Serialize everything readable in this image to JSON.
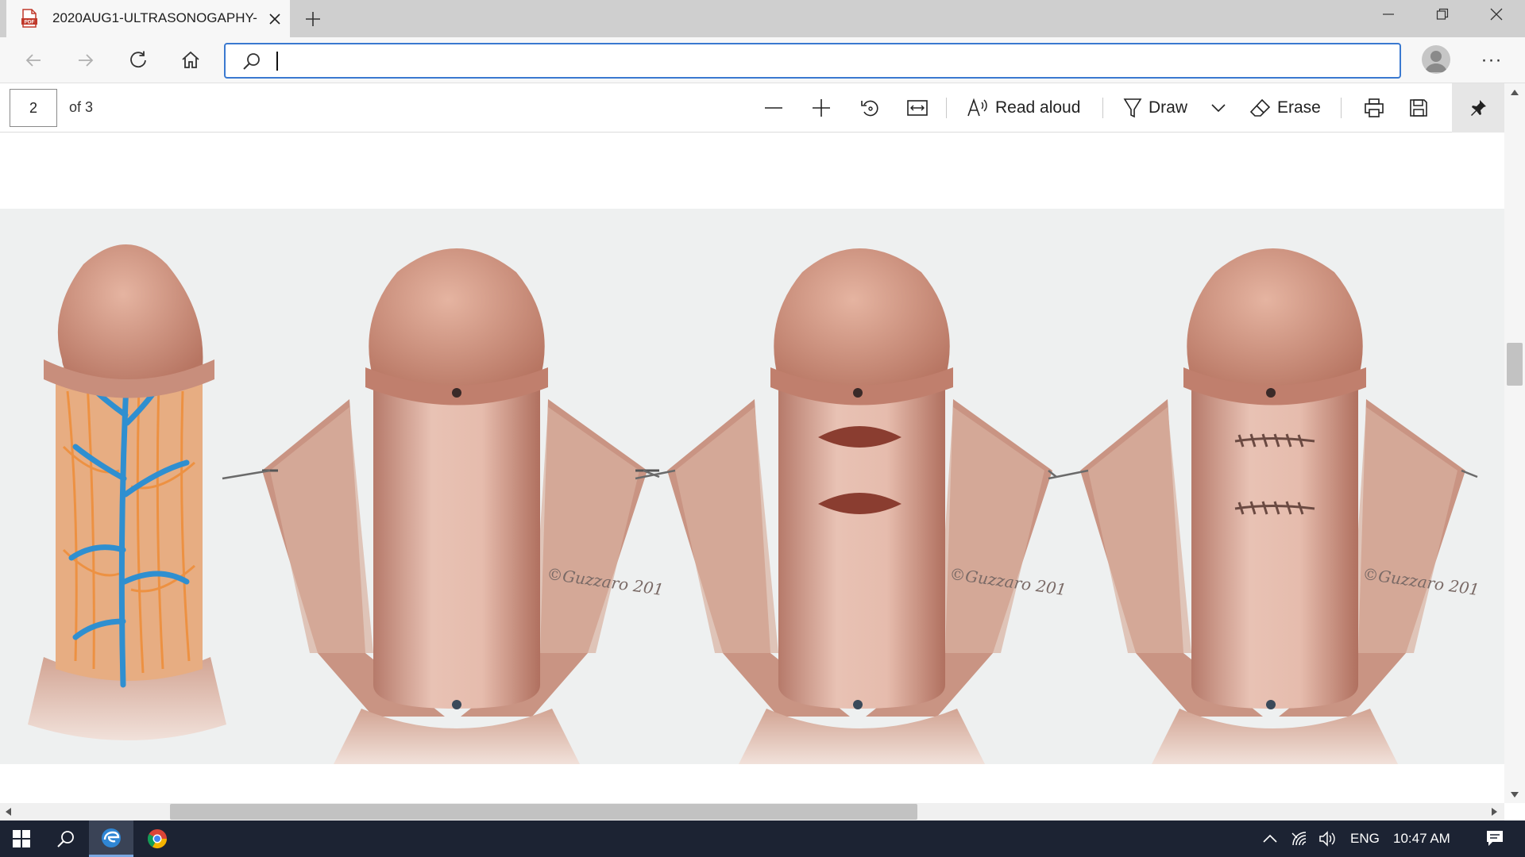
{
  "tab": {
    "title": "2020AUG1-ULTRASONOGAPHY-",
    "icon": "pdf-file-icon"
  },
  "window": {
    "new_tab": "+",
    "controls": [
      "minimize-icon",
      "restore-icon",
      "close-icon"
    ]
  },
  "navbar": {
    "back": "back-arrow-icon",
    "forward": "forward-arrow-icon",
    "refresh": "refresh-icon",
    "home": "home-icon",
    "address_value": "",
    "more": "···"
  },
  "pdf_toolbar": {
    "page_current": "2",
    "page_total_label": "of 3",
    "read_aloud_label": "Read aloud",
    "draw_label": "Draw",
    "erase_label": "Erase"
  },
  "figure": {
    "panels": 4,
    "signatures": [
      "©Guzzaro 201",
      "©Guzzaro 201",
      "©Guzzaro 201"
    ]
  },
  "taskbar": {
    "language": "ENG",
    "time": "10:47 AM"
  },
  "colors": {
    "accent": "#3a79d0",
    "tabbar": "#cfcfcf",
    "taskbar": "#1c2333",
    "skin": "#d9a08e",
    "vein": "#2f8fd0"
  }
}
